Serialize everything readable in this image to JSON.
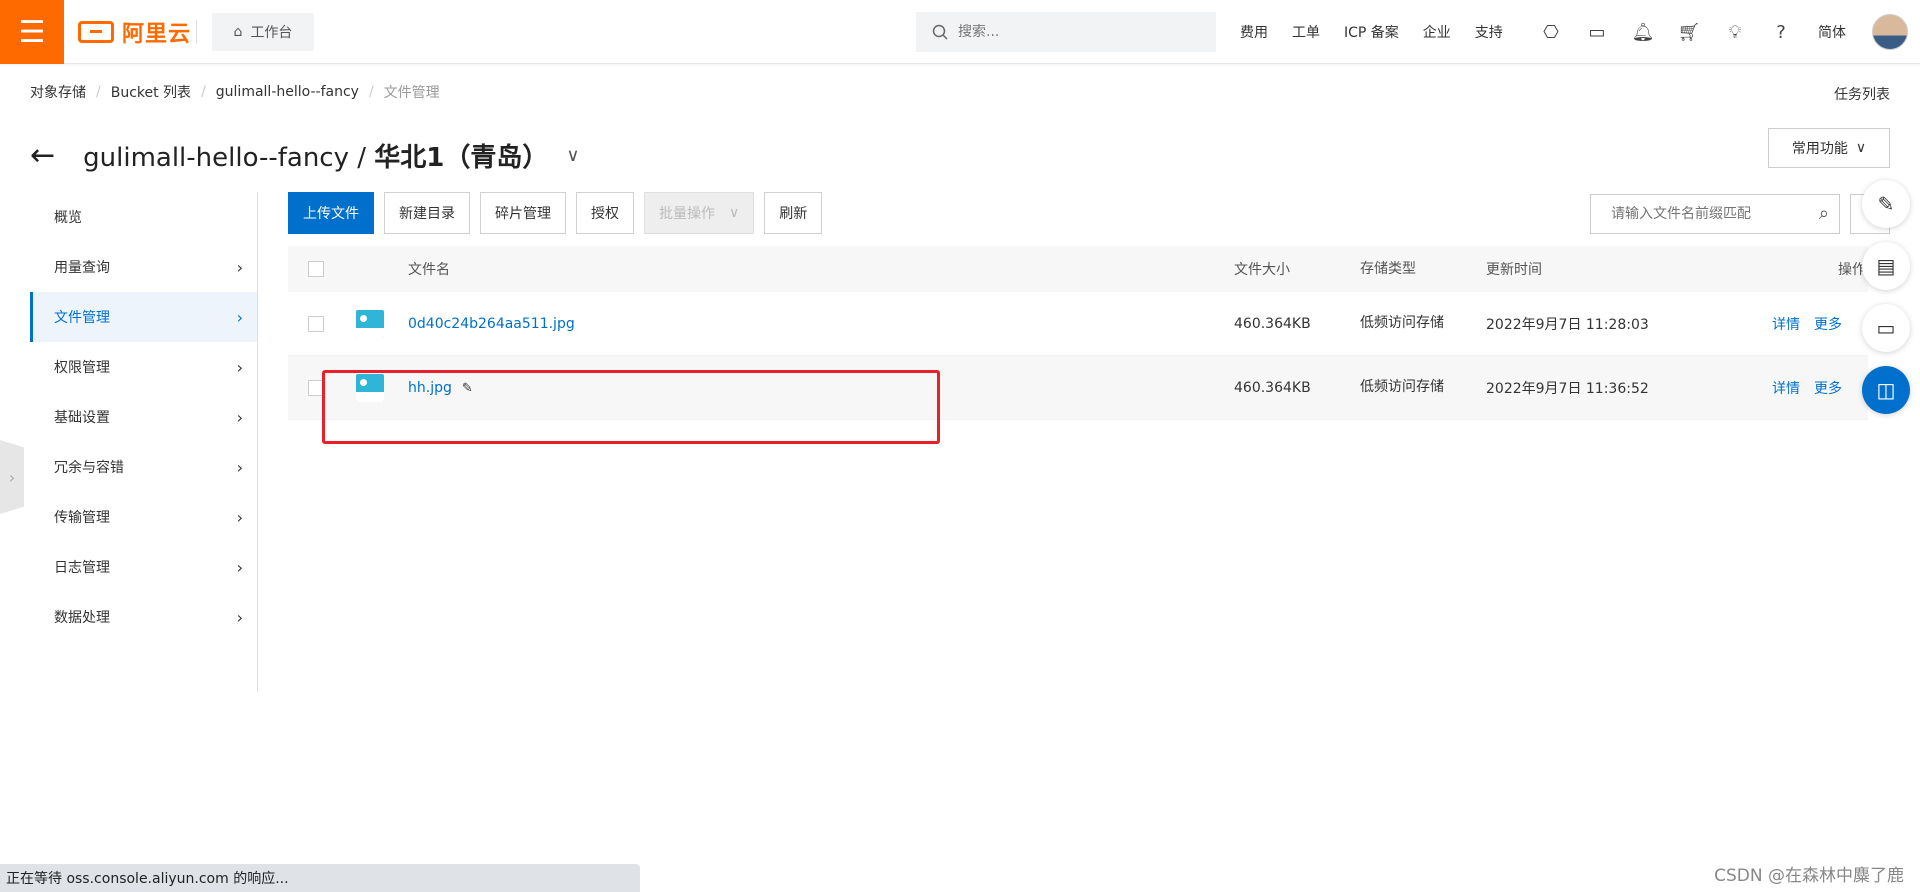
{
  "header": {
    "logo_text": "阿里云",
    "workbench": "工作台",
    "search_placeholder": "搜索...",
    "links": [
      "费用",
      "工单",
      "ICP 备案",
      "企业",
      "支持"
    ],
    "language": "简体",
    "accent_color": "#ff6a00"
  },
  "breadcrumb": {
    "items": [
      "对象存储",
      "Bucket 列表",
      "gulimall-hello--fancy"
    ],
    "current": "文件管理"
  },
  "task_list": "任务列表",
  "title": {
    "bucket": "gulimall-hello--fancy",
    "separator": " / ",
    "region": "华北1（青岛）"
  },
  "common_functions": "常用功能",
  "sidebar": {
    "items": [
      {
        "label": "概览"
      },
      {
        "label": "用量查询"
      },
      {
        "label": "文件管理"
      },
      {
        "label": "权限管理"
      },
      {
        "label": "基础设置"
      },
      {
        "label": "冗余与容错"
      },
      {
        "label": "传输管理"
      },
      {
        "label": "日志管理"
      },
      {
        "label": "数据处理"
      }
    ],
    "active": "文件管理"
  },
  "toolbar": {
    "upload": "上传文件",
    "new_dir": "新建目录",
    "fragments": "碎片管理",
    "authorize": "授权",
    "batch": "批量操作",
    "refresh": "刷新",
    "search_placeholder": "请输入文件名前缀匹配"
  },
  "table": {
    "headers": {
      "name": "文件名",
      "size": "文件大小",
      "type": "存储类型",
      "time": "更新时间",
      "ops": "操作"
    },
    "rows": [
      {
        "name": "0d40c24b264aa511.jpg",
        "size": "460.364KB",
        "type": "低频访问存储",
        "time": "2022年9月7日 11:28:03",
        "detail": "详情",
        "more": "更多"
      },
      {
        "name": "hh.jpg",
        "size": "460.364KB",
        "type": "低频访问存储",
        "time": "2022年9月7日 11:36:52",
        "detail": "详情",
        "more": "更多"
      }
    ]
  },
  "status_bar": "正在等待 oss.console.aliyun.com 的响应...",
  "watermark": "CSDN @在森林中麋了鹿"
}
